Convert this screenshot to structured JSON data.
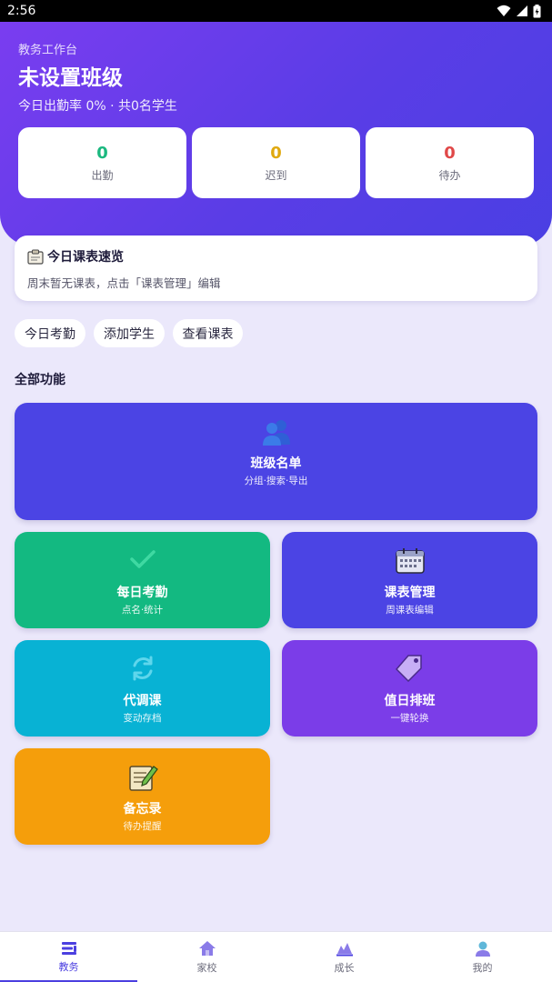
{
  "status_bar": {
    "time": "2:56"
  },
  "header": {
    "subtitle": "教务工作台",
    "title": "未设置班级",
    "rate_text": "今日出勤率 0% · 共0名学生"
  },
  "stats": [
    {
      "value": "0",
      "label": "出勤",
      "color": "#1bb87f"
    },
    {
      "value": "0",
      "label": "迟到",
      "color": "#e0a90f"
    },
    {
      "value": "0",
      "label": "待办",
      "color": "#e04848"
    }
  ],
  "schedule_card": {
    "icon": "clipboard-icon",
    "title": "今日课表速览",
    "desc": "周末暂无课表，点击「课表管理」编辑"
  },
  "quick_actions": [
    "今日考勤",
    "添加学生",
    "查看课表"
  ],
  "section_title": "全部功能",
  "tiles": [
    {
      "title": "班级名单",
      "sub": "分组·搜索·导出",
      "color": "#4b44e4",
      "icon": "people-icon"
    },
    {
      "title": "每日考勤",
      "sub": "点名·统计",
      "color": "#13b981",
      "icon": "check-icon"
    },
    {
      "title": "课表管理",
      "sub": "周课表编辑",
      "color": "#4b44e4",
      "icon": "calendar-icon"
    },
    {
      "title": "代调课",
      "sub": "变动存档",
      "color": "#08b2d4",
      "icon": "refresh-icon"
    },
    {
      "title": "值日排班",
      "sub": "一键轮换",
      "color": "#7b3de8",
      "icon": "tag-icon"
    },
    {
      "title": "备忘录",
      "sub": "待办提醒",
      "color": "#f59e0b",
      "icon": "memo-icon"
    }
  ],
  "bottom_nav": [
    {
      "label": "教务",
      "icon": "list-icon",
      "active": true
    },
    {
      "label": "家校",
      "icon": "home-icon",
      "active": false
    },
    {
      "label": "成长",
      "icon": "chart-icon",
      "active": false
    },
    {
      "label": "我的",
      "icon": "user-icon",
      "active": false
    }
  ],
  "colors": {
    "accent": "#4b3fe0",
    "background": "#ebe8fb",
    "hero_start": "#7a3df0",
    "hero_end": "#4a3fe3"
  }
}
